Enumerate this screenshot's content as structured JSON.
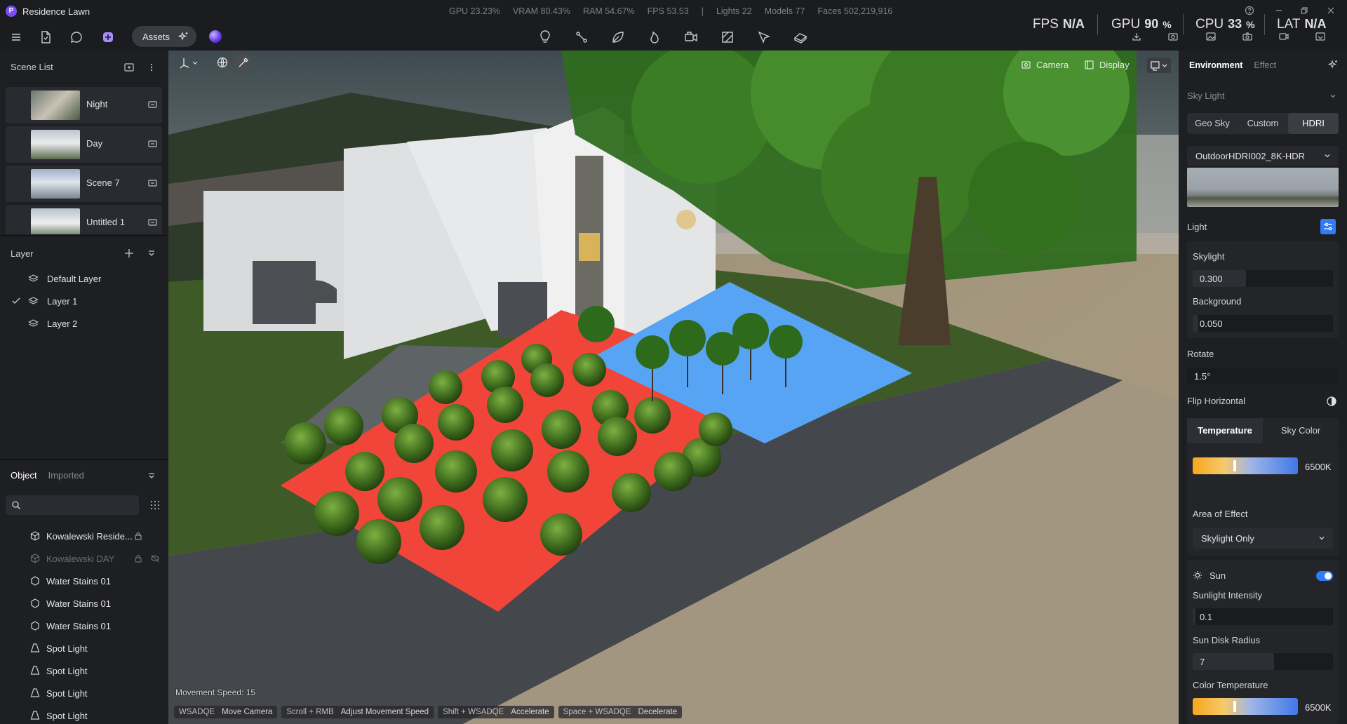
{
  "app": {
    "title": "Residence Lawn",
    "logo": "P"
  },
  "stats": [
    "GPU 23.23%",
    "VRAM 80.43%",
    "RAM 54.67%",
    "FPS 53.53",
    "|",
    "Lights 22",
    "Models 77",
    "Faces 502,219,916"
  ],
  "perf": {
    "fps": {
      "label": "FPS",
      "value": "N/A",
      "unit": ""
    },
    "gpu": {
      "label": "GPU",
      "value": "90",
      "unit": "%"
    },
    "cpu": {
      "label": "CPU",
      "value": "33",
      "unit": "%"
    },
    "lat": {
      "label": "LAT",
      "value": "N/A",
      "unit": ""
    }
  },
  "toolbar": {
    "assets_label": "Assets"
  },
  "left_panel": {
    "scene_list_title": "Scene List",
    "scenes": [
      {
        "name": "Night"
      },
      {
        "name": "Day"
      },
      {
        "name": "Scene 7"
      },
      {
        "name": "Untitled 1"
      }
    ],
    "layer_title": "Layer",
    "layers": [
      {
        "name": "Default Layer",
        "checked": false
      },
      {
        "name": "Layer 1",
        "checked": true
      },
      {
        "name": "Layer 2",
        "checked": false
      }
    ],
    "object_tabs": {
      "object": "Object",
      "imported": "Imported"
    },
    "objects": [
      {
        "name": "Kowalewski Reside...",
        "icon": "cube-icon",
        "locked": true,
        "hidden": false
      },
      {
        "name": "Kowalewski DAY",
        "icon": "cube-icon",
        "locked": true,
        "hidden": true
      },
      {
        "name": "Water Stains 01",
        "icon": "decal-icon"
      },
      {
        "name": "Water Stains 01",
        "icon": "decal-icon"
      },
      {
        "name": "Water Stains 01",
        "icon": "decal-icon"
      },
      {
        "name": "Spot Light",
        "icon": "spot-light-icon"
      },
      {
        "name": "Spot Light",
        "icon": "spot-light-icon"
      },
      {
        "name": "Spot Light",
        "icon": "spot-light-icon"
      },
      {
        "name": "Spot Light",
        "icon": "spot-light-icon"
      }
    ]
  },
  "viewport": {
    "camera_label": "Camera",
    "display_label": "Display",
    "movement_speed": "Movement Speed: 15",
    "hints": [
      {
        "key": "WSADQE",
        "action": "Move Camera"
      },
      {
        "key": "Scroll + RMB",
        "action": "Adjust Movement Speed"
      },
      {
        "key": "Shift + WSADQE",
        "action": "Accelerate"
      },
      {
        "key": "Space + WSADQE",
        "action": "Decelerate"
      }
    ]
  },
  "right_panel": {
    "tabs": {
      "environment": "Environment",
      "effect": "Effect"
    },
    "sky_light_title": "Sky Light",
    "sky_modes": [
      "Geo Sky",
      "Custom",
      "HDRI"
    ],
    "sky_mode_selected": "HDRI",
    "hdri_name": "OutdoorHDRI002_8K-HDR",
    "light_title": "Light",
    "skylight_label": "Skylight",
    "skylight_value": "0.300",
    "background_label": "Background",
    "background_value": "0.050",
    "rotate_label": "Rotate",
    "rotate_value": "1.5°",
    "flip_label": "Flip Horizontal",
    "temp_tabs": [
      "Temperature",
      "Sky Color"
    ],
    "temperature_value": "6500K",
    "temperature_slider": 0.4,
    "area_label": "Area of Effect",
    "area_value": "Skylight Only",
    "sun_label": "Sun",
    "sun_enabled": true,
    "sunlight_intensity_label": "Sunlight Intensity",
    "sunlight_intensity_value": "0.1",
    "sun_disk_label": "Sun Disk Radius",
    "sun_disk_value": "7",
    "sun_disk_fill": 0.58,
    "color_temp_label": "Color Temperature",
    "color_temp_value": "6500K",
    "color_temp_slider": 0.4
  },
  "colors": {
    "accent": "#2f7cf6",
    "logo": "#7b4cf5",
    "red_zone": "#f2453a",
    "blue_zone": "#58a4f4"
  }
}
